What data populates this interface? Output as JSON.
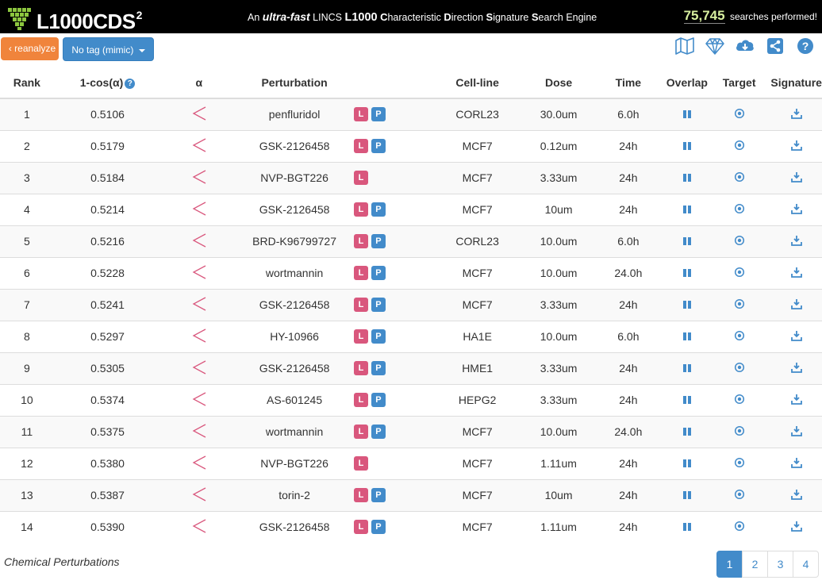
{
  "header": {
    "logo_text": "L1000CDS",
    "logo_sup": "2",
    "tagline": {
      "an": "An",
      "ultra": "ultra-fast",
      "lincs": "LINCS",
      "l1000": "L1000",
      "c": "C",
      "c_rest": "haracteristic",
      "d": "D",
      "d_rest": "irection",
      "s": "S",
      "s_rest": "ignature",
      "s2": "S",
      "s2_rest": "earch",
      "engine": "Engine"
    },
    "counter_value": "75,745",
    "counter_label": "searches performed!"
  },
  "toolbar": {
    "reanalyze_label": "reanalyze",
    "tag_label": "No tag (mimic)",
    "icons": [
      "map-icon",
      "diamond-icon",
      "cloud-download-icon",
      "share-icon",
      "help-icon"
    ]
  },
  "table": {
    "headers": {
      "rank": "Rank",
      "score": "1-cos(α)",
      "alpha": "α",
      "perturbation": "Perturbation",
      "cell_line": "Cell-line",
      "dose": "Dose",
      "time": "Time",
      "overlap": "Overlap",
      "target": "Target",
      "signature": "Signature"
    },
    "rows": [
      {
        "rank": "1",
        "score": "0.5106",
        "pert": "penfluridol",
        "L": true,
        "P": true,
        "cell": "CORL23",
        "dose": "30.0um",
        "time": "6.0h"
      },
      {
        "rank": "2",
        "score": "0.5179",
        "pert": "GSK-2126458",
        "L": true,
        "P": true,
        "cell": "MCF7",
        "dose": "0.12um",
        "time": "24h"
      },
      {
        "rank": "3",
        "score": "0.5184",
        "pert": "NVP-BGT226",
        "L": true,
        "P": false,
        "cell": "MCF7",
        "dose": "3.33um",
        "time": "24h"
      },
      {
        "rank": "4",
        "score": "0.5214",
        "pert": "GSK-2126458",
        "L": true,
        "P": true,
        "cell": "MCF7",
        "dose": "10um",
        "time": "24h"
      },
      {
        "rank": "5",
        "score": "0.5216",
        "pert": "BRD-K96799727",
        "L": true,
        "P": true,
        "cell": "CORL23",
        "dose": "10.0um",
        "time": "6.0h"
      },
      {
        "rank": "6",
        "score": "0.5228",
        "pert": "wortmannin",
        "L": true,
        "P": true,
        "cell": "MCF7",
        "dose": "10.0um",
        "time": "24.0h"
      },
      {
        "rank": "7",
        "score": "0.5241",
        "pert": "GSK-2126458",
        "L": true,
        "P": true,
        "cell": "MCF7",
        "dose": "3.33um",
        "time": "24h"
      },
      {
        "rank": "8",
        "score": "0.5297",
        "pert": "HY-10966",
        "L": true,
        "P": true,
        "cell": "HA1E",
        "dose": "10.0um",
        "time": "6.0h"
      },
      {
        "rank": "9",
        "score": "0.5305",
        "pert": "GSK-2126458",
        "L": true,
        "P": true,
        "cell": "HME1",
        "dose": "3.33um",
        "time": "24h"
      },
      {
        "rank": "10",
        "score": "0.5374",
        "pert": "AS-601245",
        "L": true,
        "P": true,
        "cell": "HEPG2",
        "dose": "3.33um",
        "time": "24h"
      },
      {
        "rank": "11",
        "score": "0.5375",
        "pert": "wortmannin",
        "L": true,
        "P": true,
        "cell": "MCF7",
        "dose": "10.0um",
        "time": "24.0h"
      },
      {
        "rank": "12",
        "score": "0.5380",
        "pert": "NVP-BGT226",
        "L": true,
        "P": false,
        "cell": "MCF7",
        "dose": "1.11um",
        "time": "24h"
      },
      {
        "rank": "13",
        "score": "0.5387",
        "pert": "torin-2",
        "L": true,
        "P": true,
        "cell": "MCF7",
        "dose": "10um",
        "time": "24h"
      },
      {
        "rank": "14",
        "score": "0.5390",
        "pert": "GSK-2126458",
        "L": true,
        "P": true,
        "cell": "MCF7",
        "dose": "1.11um",
        "time": "24h"
      }
    ],
    "badge_l": "L",
    "badge_p": "P"
  },
  "footer": {
    "caption": "Chemical Perturbations",
    "pages": [
      "1",
      "2",
      "3",
      "4"
    ],
    "active_page": "1"
  },
  "colors": {
    "accent_blue": "#428bca",
    "orange": "#f0843c",
    "pink": "#d9577d",
    "counter_green": "#d8f0a0"
  }
}
